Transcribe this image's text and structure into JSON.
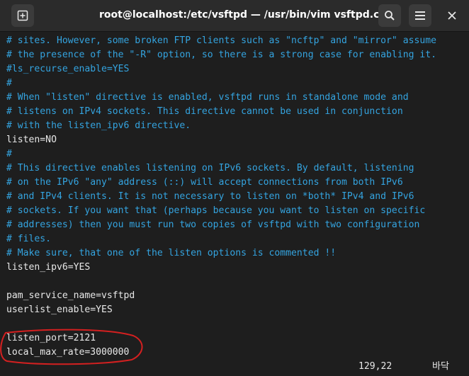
{
  "window": {
    "title": "root@localhost:/etc/vsftpd — /usr/bin/vim vsftpd.conf",
    "buttons": {
      "new_tab": "new-tab-icon",
      "search": "search-icon",
      "menu": "hamburger-menu-icon",
      "close": "close-icon"
    }
  },
  "editor": {
    "lines": [
      {
        "text": "# sites. However, some broken FTP clients such as \"ncftp\" and \"mirror\" assume",
        "type": "comment"
      },
      {
        "text": "# the presence of the \"-R\" option, so there is a strong case for enabling it.",
        "type": "comment"
      },
      {
        "text": "#ls_recurse_enable=YES",
        "type": "comment"
      },
      {
        "text": "#",
        "type": "comment"
      },
      {
        "text": "# When \"listen\" directive is enabled, vsftpd runs in standalone mode and",
        "type": "comment"
      },
      {
        "text": "# listens on IPv4 sockets. This directive cannot be used in conjunction",
        "type": "comment"
      },
      {
        "text": "# with the listen_ipv6 directive.",
        "type": "comment"
      },
      {
        "text": "listen=NO",
        "type": "plain"
      },
      {
        "text": "#",
        "type": "comment"
      },
      {
        "text": "# This directive enables listening on IPv6 sockets. By default, listening",
        "type": "comment"
      },
      {
        "text": "# on the IPv6 \"any\" address (::) will accept connections from both IPv6",
        "type": "comment"
      },
      {
        "text": "# and IPv4 clients. It is not necessary to listen on *both* IPv4 and IPv6",
        "type": "comment"
      },
      {
        "text": "# sockets. If you want that (perhaps because you want to listen on specific",
        "type": "comment"
      },
      {
        "text": "# addresses) then you must run two copies of vsftpd with two configuration",
        "type": "comment"
      },
      {
        "text": "# files.",
        "type": "comment"
      },
      {
        "text": "# Make sure, that one of the listen options is commented !!",
        "type": "comment"
      },
      {
        "text": "listen_ipv6=YES",
        "type": "plain"
      },
      {
        "text": "",
        "type": "plain"
      },
      {
        "text": "pam_service_name=vsftpd",
        "type": "plain"
      },
      {
        "text": "userlist_enable=YES",
        "type": "plain"
      },
      {
        "text": "",
        "type": "plain"
      },
      {
        "text": "listen_port=2121",
        "type": "plain"
      },
      {
        "text": "local_max_rate=3000000",
        "type": "plain"
      }
    ]
  },
  "status": {
    "cursor_position": "129,22",
    "scroll_position": "바닥"
  },
  "colors": {
    "background": "#1e1e1e",
    "titlebar": "#2b2b2b",
    "comment": "#34a4e0",
    "text": "#e8e8e8",
    "annotation": "#d42020"
  }
}
